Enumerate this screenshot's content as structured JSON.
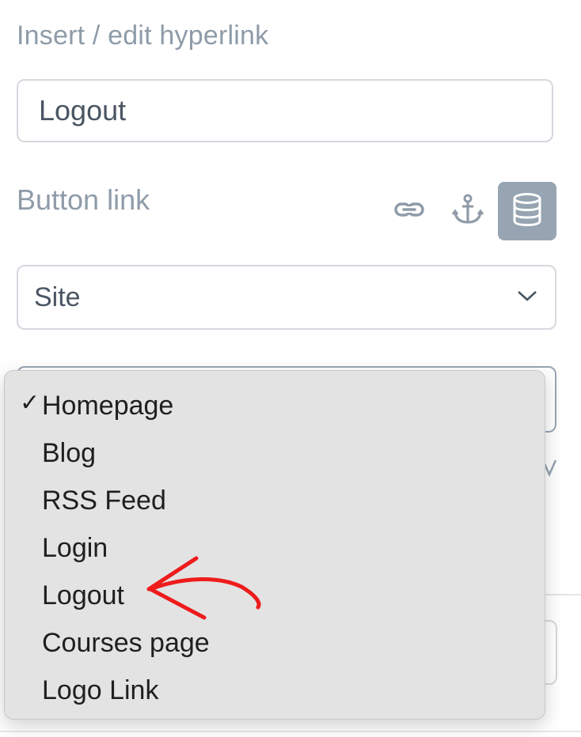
{
  "dialog": {
    "title": "Insert / edit hyperlink"
  },
  "text_field": {
    "value": "Logout"
  },
  "button_link": {
    "label": "Button link",
    "types": [
      {
        "name": "url",
        "icon": "link-icon",
        "active": false
      },
      {
        "name": "anchor",
        "icon": "anchor-icon",
        "active": false
      },
      {
        "name": "database",
        "icon": "database-icon",
        "active": true
      }
    ]
  },
  "source_select": {
    "selected": "Site"
  },
  "page_menu": {
    "items": [
      {
        "label": "Homepage",
        "checked": true
      },
      {
        "label": "Blog",
        "checked": false
      },
      {
        "label": "RSS Feed",
        "checked": false
      },
      {
        "label": "Login",
        "checked": false
      },
      {
        "label": "Logout",
        "checked": false
      },
      {
        "label": "Courses page",
        "checked": false
      },
      {
        "label": "Logo Link",
        "checked": false
      }
    ],
    "check_glyph": "✓"
  },
  "annotation": {
    "color": "#ee1c1c",
    "points_to": "Logout"
  },
  "colors": {
    "muted_text": "#8f9ba8",
    "input_text": "#4a5563",
    "active_icon_bg": "#97a4b2",
    "menu_bg": "#e3e3e3"
  }
}
